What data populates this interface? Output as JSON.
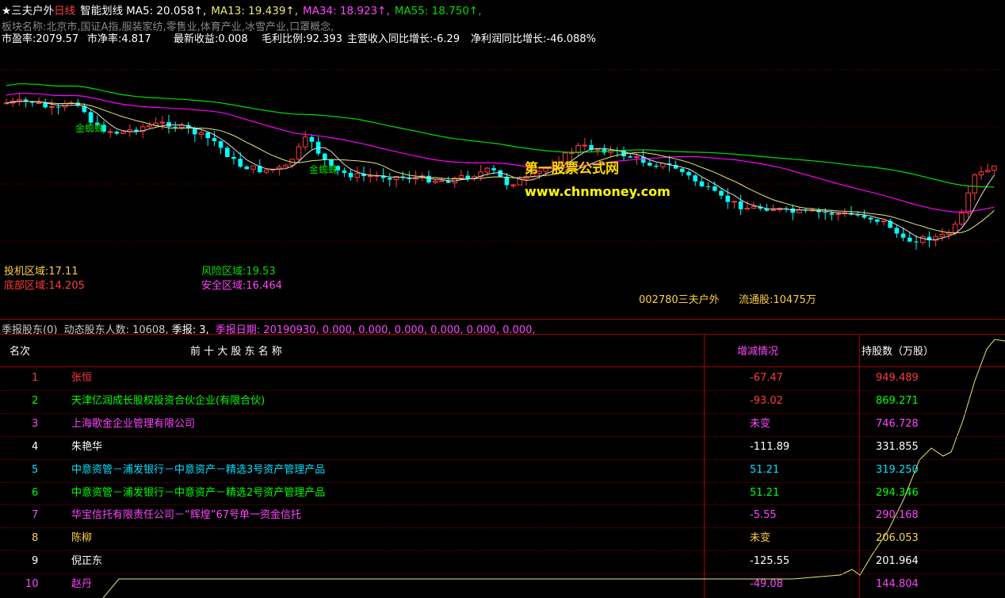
{
  "header": {
    "star": "★",
    "stock_name": "三夫户外",
    "period": "日线",
    "indicator": "智能划线",
    "ma5": "MA5: 20.058↑,",
    "ma13": "MA13: 19.439↑,",
    "ma34": "MA34: 18.923↑,",
    "ma55": "MA55: 18.750↑,"
  },
  "sector": "板块名称:北京市,国证A指,服装家纺,零售业,体育产业,冰雪产业,口罩概念,",
  "fundamentals": {
    "pe": "市盈率:2079.57",
    "pb": "市净率:4.817",
    "eps": "最新收益:0.008",
    "gross": "毛利比例:92.393",
    "rev_growth": "主营收入同比增长:-6.29",
    "profit_growth": "净利润同比增长:-46.088%"
  },
  "annotations": {
    "golden_spider_1": "金蜘蛛",
    "golden_spider_2": "金蜘蛛",
    "watermark_cn": "第一股票公式网",
    "watermark_url": "www.chnmoney.com"
  },
  "zones": {
    "speculative": "投机区域:17.11",
    "bottom": "底部区域:14.205",
    "risk": "风险区域:19.53",
    "safe": "安全区域:16.464"
  },
  "stock_info": {
    "code_name": "002780三夫户外",
    "float_shares": "流通股:10475万"
  },
  "quarterly_bar": {
    "title": "季报股东(0)",
    "holders": "动态股东人数: 10608,",
    "quarter": "季报: 3,",
    "date_label": "季报日期:",
    "values": "20190930, 0.000, 0.000, 0.000, 0.000, 0.000, 0.000,"
  },
  "table": {
    "headers": {
      "rank": "名次",
      "name": "前 十 大 股 东 名 称",
      "change": "增减情况",
      "shares": "持股数（万股）"
    },
    "rows": [
      {
        "rank": "1",
        "name": "张恒",
        "change": "-67.47",
        "shares": "949.489",
        "name_color": "#ff3c3c",
        "change_color": "#ff3c3c",
        "shares_color": "#ff3c3c"
      },
      {
        "rank": "2",
        "name": "天津亿润成长股权投资合伙企业(有限合伙)",
        "change": "-93.02",
        "shares": "869.271",
        "name_color": "#00ff00",
        "change_color": "#ff3c3c",
        "shares_color": "#00ff00"
      },
      {
        "rank": "3",
        "name": "上海歌金企业管理有限公司",
        "change": "未变",
        "shares": "746.728",
        "name_color": "#ff44ff",
        "change_color": "#ff44ff",
        "shares_color": "#ff44ff"
      },
      {
        "rank": "4",
        "name": "朱艳华",
        "change": "-111.89",
        "shares": "331.855",
        "name_color": "#ffffff",
        "change_color": "#ffffff",
        "shares_color": "#ffffff"
      },
      {
        "rank": "5",
        "name": "中意资管－浦发银行－中意资产－精选3号资产管理产品",
        "change": "51.21",
        "shares": "319.250",
        "name_color": "#00e0ff",
        "change_color": "#00e0ff",
        "shares_color": "#00e0ff"
      },
      {
        "rank": "6",
        "name": "中意资管－浦发银行－中意资产－精选2号资产管理产品",
        "change": "51.21",
        "shares": "294.346",
        "name_color": "#00ff00",
        "change_color": "#00ff00",
        "shares_color": "#00ff00"
      },
      {
        "rank": "7",
        "name": "华宝信托有限责任公司－“辉煌”67号单一资金信托",
        "change": "-5.55",
        "shares": "290.168",
        "name_color": "#ff44ff",
        "change_color": "#ff44ff",
        "shares_color": "#ff44ff"
      },
      {
        "rank": "8",
        "name": "陈柳",
        "change": "未变",
        "shares": "206.053",
        "name_color": "#ffd040",
        "change_color": "#ffd040",
        "shares_color": "#ffd040"
      },
      {
        "rank": "9",
        "name": "倪正东",
        "change": "-125.55",
        "shares": "201.964",
        "name_color": "#ffffff",
        "change_color": "#ffffff",
        "shares_color": "#ffffff"
      },
      {
        "rank": "10",
        "name": "赵丹",
        "change": "-49.08",
        "shares": "144.804",
        "name_color": "#ff44ff",
        "change_color": "#ff44ff",
        "shares_color": "#ff44ff"
      }
    ]
  },
  "colors": {
    "up": "#ff3c3c",
    "down": "#00ffff",
    "ma_yellow": "#e8e870",
    "ma_magenta": "#ff00ff",
    "ma_green": "#00dd00",
    "grid_red": "#a00000"
  }
}
